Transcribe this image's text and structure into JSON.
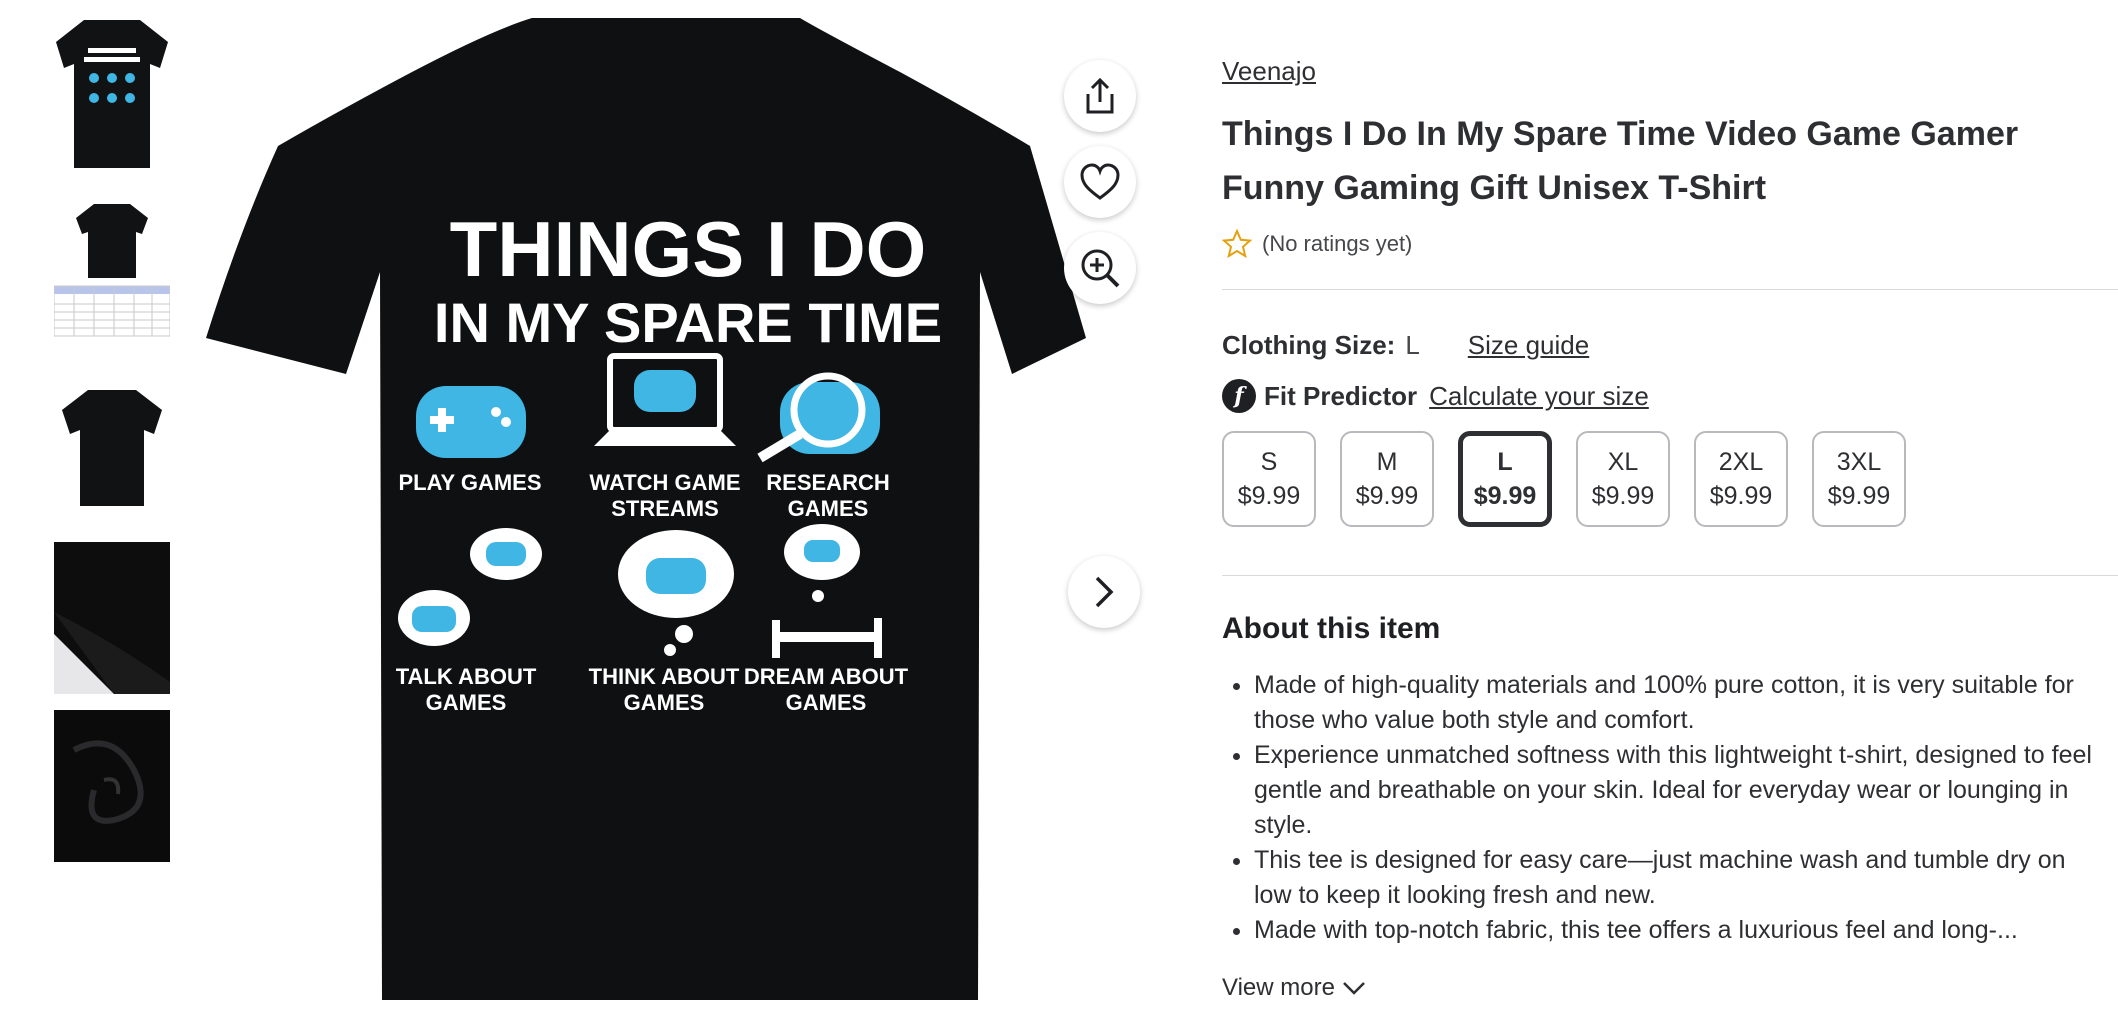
{
  "thumbnails": [
    {
      "alt": "Front design thumbnail"
    },
    {
      "alt": "Size chart thumbnail"
    },
    {
      "alt": "Plain back thumbnail"
    },
    {
      "alt": "Fabric close-up thumbnail"
    },
    {
      "alt": "Fabric swirl thumbnail"
    }
  ],
  "shirt_art": {
    "headline_1": "THINGS I DO",
    "headline_2": "IN MY SPARE TIME",
    "items": [
      [
        "PLAY GAMES"
      ],
      [
        "WATCH GAME",
        "STREAMS"
      ],
      [
        "RESEARCH",
        "GAMES"
      ],
      [
        "TALK ABOUT",
        "GAMES"
      ],
      [
        "THINK ABOUT",
        "GAMES"
      ],
      [
        "DREAM ABOUT",
        "GAMES"
      ]
    ],
    "colors": {
      "shirt": "#0f1011",
      "ink": "#ffffff",
      "accent": "#3fb6e3"
    }
  },
  "actions": {
    "share_icon": "share-icon",
    "favorite_icon": "heart-icon",
    "zoom_icon": "zoom-in-icon",
    "next_icon": "chevron-right-icon"
  },
  "product": {
    "brand": "Veenajo",
    "title": "Things I Do In My Spare Time Video Game Gamer Funny Gaming Gift Unisex T-Shirt",
    "rating_text": "(No ratings yet)",
    "star_color": "#ffc220"
  },
  "size_selector": {
    "label": "Clothing Size:",
    "selected": "L",
    "guide_link": "Size guide",
    "fit_logo": "f",
    "fit_label": "Fit Predictor",
    "fit_link": "Calculate your size",
    "options": [
      {
        "size": "S",
        "price": "$9.99"
      },
      {
        "size": "M",
        "price": "$9.99"
      },
      {
        "size": "L",
        "price": "$9.99"
      },
      {
        "size": "XL",
        "price": "$9.99"
      },
      {
        "size": "2XL",
        "price": "$9.99"
      },
      {
        "size": "3XL",
        "price": "$9.99"
      }
    ]
  },
  "about": {
    "title": "About this item",
    "bullets": [
      "Made of high-quality materials and 100% pure cotton, it is very suitable for those who value both style and comfort.",
      "Experience unmatched softness with this lightweight t-shirt, designed to feel gentle and breathable on your skin. Ideal for everyday wear or lounging in style.",
      "This tee is designed for easy care—just machine wash and tumble dry on low to keep it looking fresh and new.",
      "Made with top-notch fabric, this tee offers a luxurious feel and long-..."
    ],
    "view_more": "View more"
  }
}
